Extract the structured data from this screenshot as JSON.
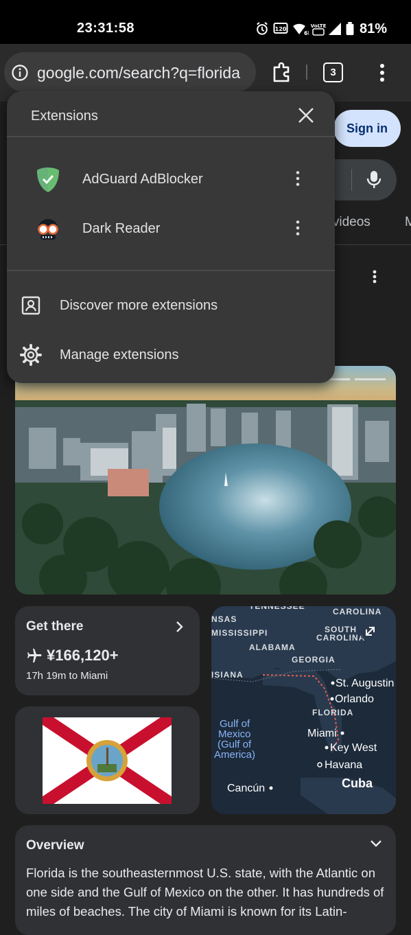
{
  "status_bar": {
    "time": "23:31:58",
    "battery": "81%"
  },
  "toolbar": {
    "url": "google.com/search?q=florida",
    "tab_count": "3"
  },
  "page": {
    "sign_in": "Sign in",
    "tab_partial": "rt videos",
    "get_there": {
      "title": "Get there",
      "price": "¥166,120+",
      "duration": "17h 19m to Miami"
    },
    "map_labels": [
      "TENNESSEE",
      "CAROLINA",
      "NSAS",
      "MISSISSIPPI",
      "SOUTH",
      "CAROLINA",
      "ALABAMA",
      "GEORGIA",
      "ISIANA",
      "St. Augustin",
      "Orlando",
      "FLORIDA",
      "Gulf of",
      "Mexico",
      "(Gulf of",
      "America)",
      "Miami",
      "Key West",
      "Havana",
      "Cancún",
      "Cuba"
    ],
    "overview": {
      "title": "Overview",
      "text": "Florida is the southeasternmost U.S. state, with the Atlantic on one side and the Gulf of Mexico on the other. It has hundreds of miles of beaches. The city of Miami is known for its Latin-"
    }
  },
  "extensions_popup": {
    "title": "Extensions",
    "items": [
      {
        "name": "AdGuard AdBlocker",
        "icon": "adguard-shield-icon"
      },
      {
        "name": "Dark Reader",
        "icon": "dark-reader-icon"
      }
    ],
    "actions": [
      {
        "label": "Discover more extensions",
        "icon": "store-icon"
      },
      {
        "label": "Manage extensions",
        "icon": "gear-icon"
      }
    ]
  },
  "colors": {
    "popup_bg": "#383838",
    "page_bg": "#1f1f1f",
    "signin_bg": "#d3e3fd",
    "adguard_green": "#68bc71"
  }
}
